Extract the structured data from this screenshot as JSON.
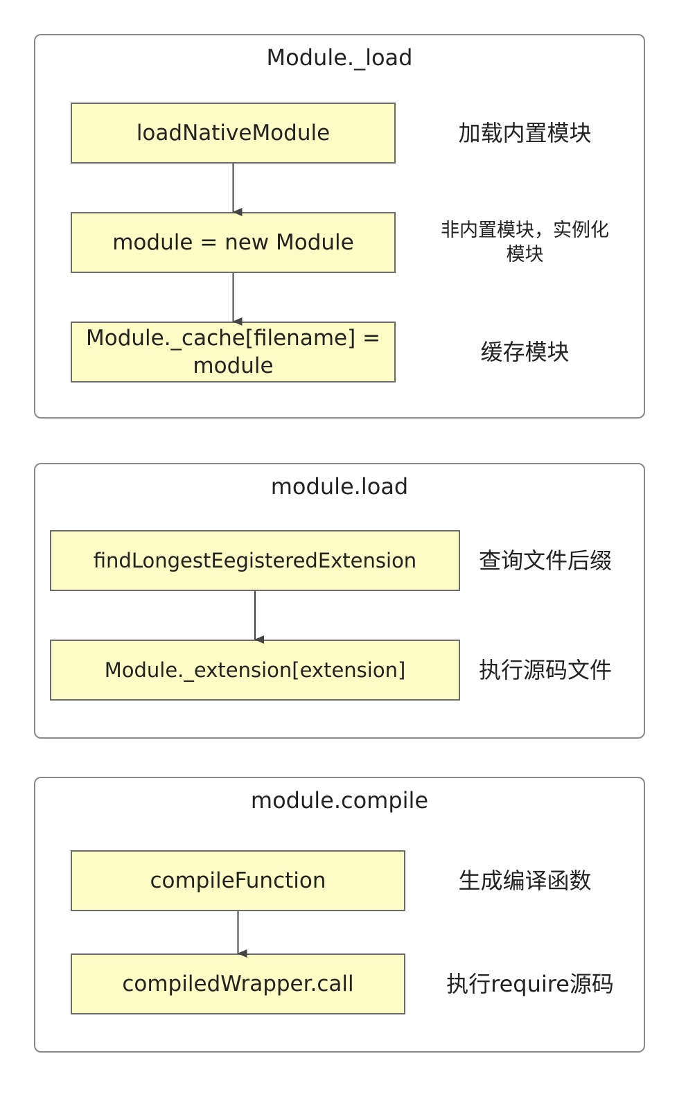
{
  "groups": [
    {
      "title": "Module._load",
      "nodes": [
        {
          "label": "loadNativeModule",
          "note": "加载内置模块"
        },
        {
          "label": "module = new Module",
          "note": "非内置模块，实例化模块"
        },
        {
          "label": "Module._cache[filename] = module",
          "note": "缓存模块"
        }
      ]
    },
    {
      "title": "module.load",
      "nodes": [
        {
          "label": "findLongestEegisteredExtension",
          "note": "查询文件后缀"
        },
        {
          "label": "Module._extension[extension]",
          "note": "执行源码文件"
        }
      ]
    },
    {
      "title": "module.compile",
      "nodes": [
        {
          "label": "compileFunction",
          "note": "生成编译函数"
        },
        {
          "label": "compiledWrapper.call",
          "note": "执行require源码"
        }
      ]
    }
  ],
  "edges": [
    {
      "from": "g0n0",
      "to": "g0n1"
    },
    {
      "from": "g0n1",
      "to": "g0n2"
    },
    {
      "from": "g1n0",
      "to": "g1n1"
    },
    {
      "from": "g2n0",
      "to": "g2n1"
    }
  ],
  "colors": {
    "node_fill": "#fdfcc4",
    "node_border": "#6b6b6b",
    "group_border": "#8a8a8a",
    "arrow": "#444444"
  }
}
